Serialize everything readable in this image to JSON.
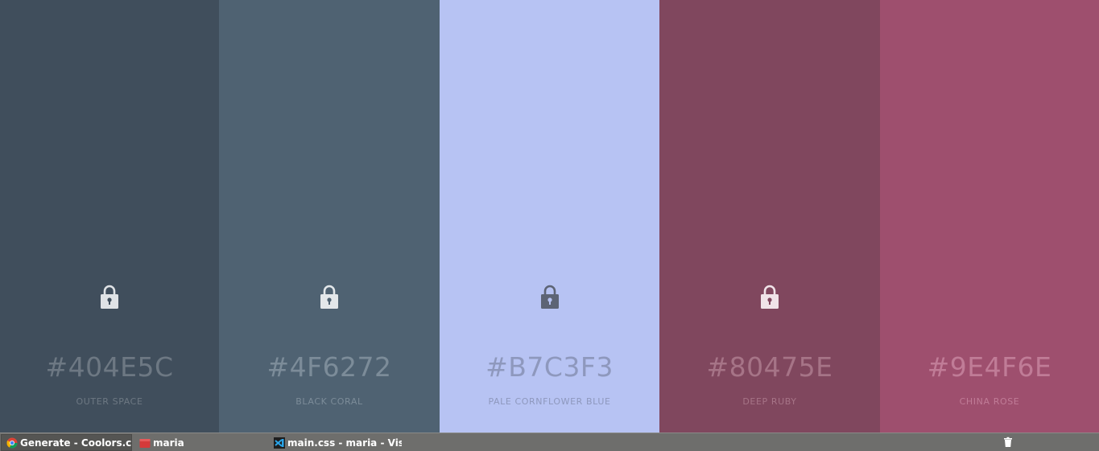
{
  "palette": {
    "colors": [
      {
        "hex": "#404E5C",
        "name": "OUTER SPACE",
        "bg": "#404e5c",
        "text_color": "#6d7883",
        "lock_color": "#dfe2e5",
        "lock_hole": "#404e5c"
      },
      {
        "hex": "#4F6272",
        "name": "BLACK CORAL",
        "bg": "#4f6272",
        "text_color": "#7c8c99",
        "lock_color": "#e3e7ea",
        "lock_hole": "#4f6272"
      },
      {
        "hex": "#B7C3F3",
        "name": "PALE CORNFLOWER BLUE",
        "bg": "#b7c3f3",
        "text_color": "#8e98bd",
        "lock_color": "#5d6475",
        "lock_hole": "#b7c3f3"
      },
      {
        "hex": "#80475E",
        "name": "DEEP RUBY",
        "bg": "#80475e",
        "text_color": "#a67487",
        "lock_color": "#f0e3e8",
        "lock_hole": "#80475e"
      },
      {
        "hex": "#9E4F6E",
        "name": "CHINA ROSE",
        "bg": "#9e4f6e",
        "text_color": "#c07c97",
        "lock_color": null,
        "lock_hole": null
      }
    ]
  },
  "taskbar": {
    "tasks": [
      {
        "label": "Generate - Coolors.c...",
        "icon": "chrome-icon"
      },
      {
        "label": "maria",
        "icon": "folder-icon"
      },
      {
        "label": "main.css - maria - Vis...",
        "icon": "vscode-icon"
      }
    ],
    "trash_icon": "trash-icon"
  }
}
